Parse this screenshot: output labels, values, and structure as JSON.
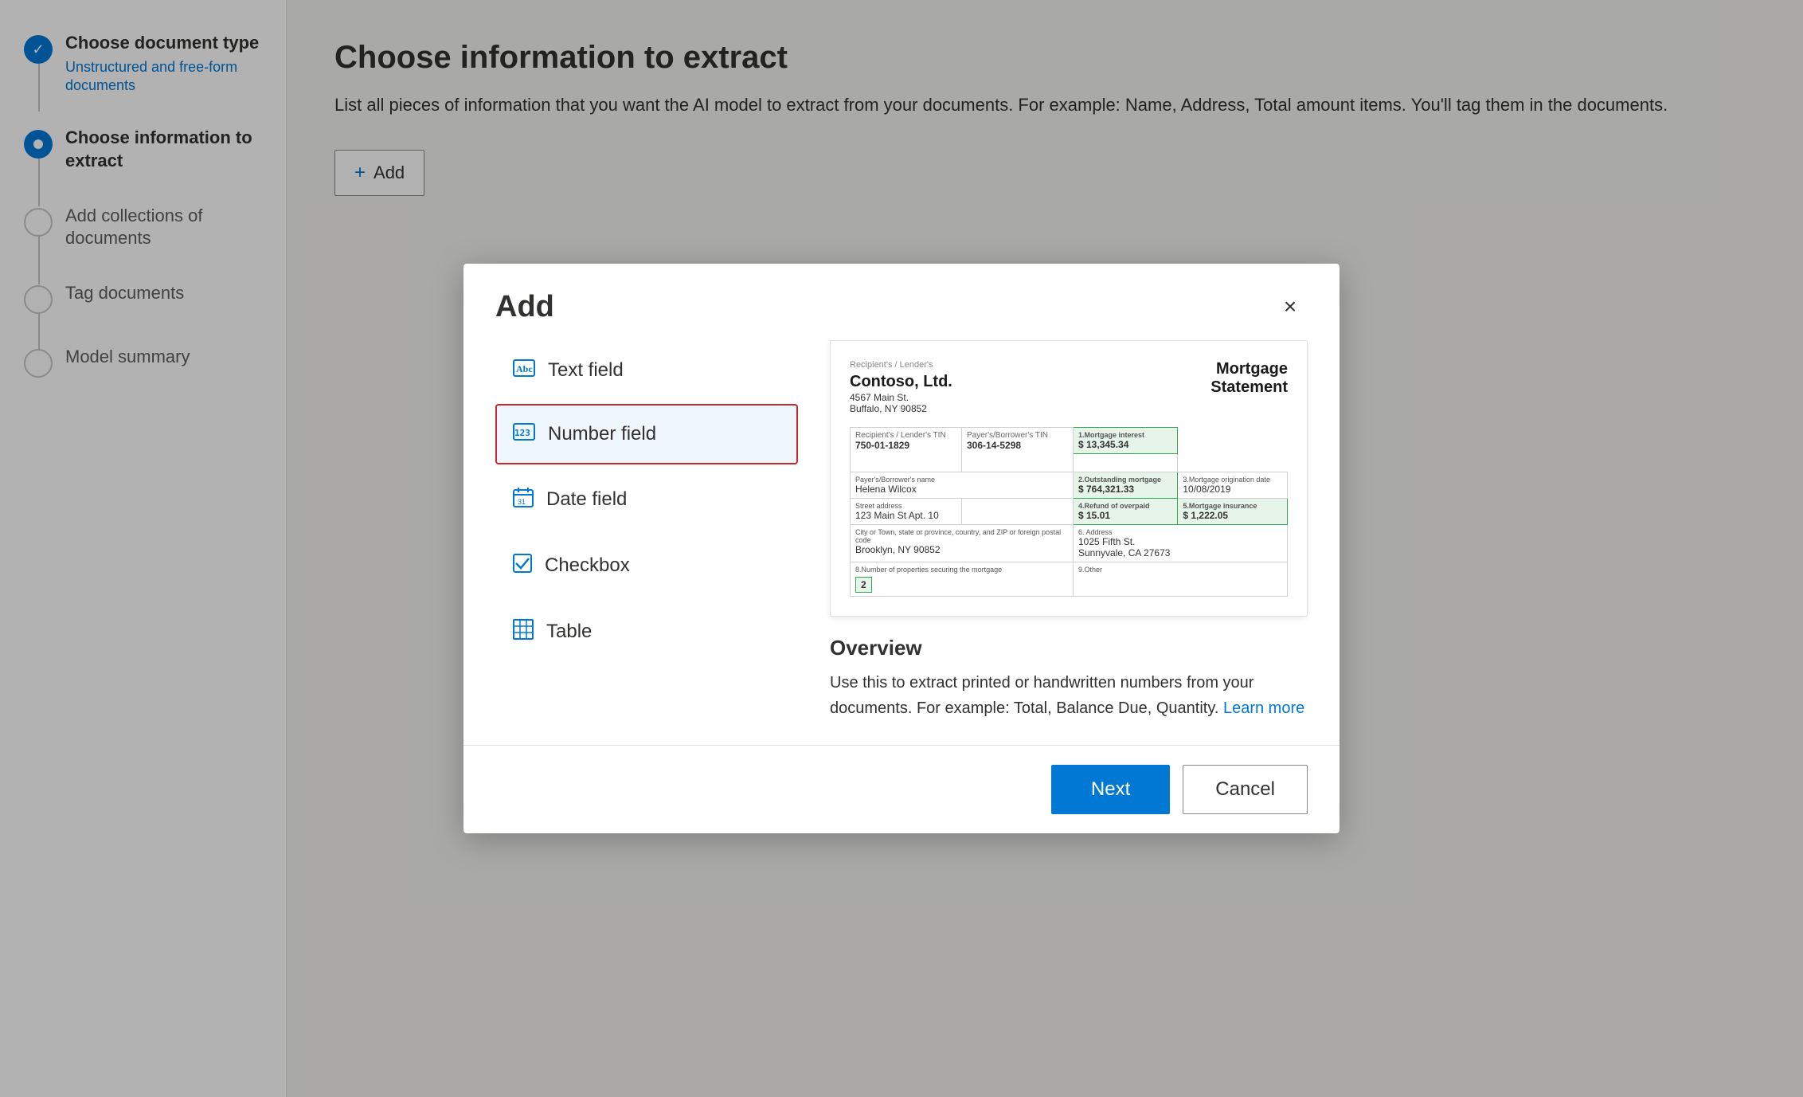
{
  "sidebar": {
    "steps": [
      {
        "id": "choose-document-type",
        "label": "Choose document type",
        "sublabel": "Unstructured and free-form documents",
        "state": "completed",
        "icon": "✓"
      },
      {
        "id": "choose-information",
        "label": "Choose information to extract",
        "sublabel": "",
        "state": "active",
        "icon": "●"
      },
      {
        "id": "add-collections",
        "label": "Add collections of documents",
        "sublabel": "",
        "state": "inactive",
        "icon": ""
      },
      {
        "id": "tag-documents",
        "label": "Tag documents",
        "sublabel": "",
        "state": "inactive",
        "icon": ""
      },
      {
        "id": "model-summary",
        "label": "Model summary",
        "sublabel": "",
        "state": "inactive",
        "icon": ""
      }
    ]
  },
  "main": {
    "title": "Choose information to extract",
    "description": "List all pieces of information that you want the AI model to extract from your documents. For example: Name, Address, Total amount items. You'll tag them in the documents.",
    "add_button_label": "Add"
  },
  "modal": {
    "title": "Add",
    "close_label": "×",
    "fields": [
      {
        "id": "text-field",
        "label": "Text field",
        "icon": "Abc",
        "selected": false
      },
      {
        "id": "number-field",
        "label": "Number field",
        "icon": "123",
        "selected": true
      },
      {
        "id": "date-field",
        "label": "Date field",
        "icon": "📅",
        "selected": false
      },
      {
        "id": "checkbox",
        "label": "Checkbox",
        "icon": "☑",
        "selected": false
      },
      {
        "id": "table",
        "label": "Table",
        "icon": "⊞",
        "selected": false
      }
    ],
    "preview": {
      "document": {
        "company": "Contoso, Ltd.",
        "address": "4567 Main St.\nBuffalo, NY 90852",
        "doc_type": "Mortgage\nStatement",
        "recipient_tin_label": "Recipient's / Lender's TIN",
        "recipient_tin": "750-01-1829",
        "payer_tin_label": "Payer's/Borrower's TIN",
        "payer_tin": "306-14-5298",
        "mortgage_interest_label": "1.Mortgage interest",
        "mortgage_interest": "$ 13,345.34",
        "outstanding_mortgage_label": "2.Outstanding mortgage",
        "outstanding_mortgage": "$ 764,321.33",
        "origination_date_label": "3.Mortgage origination date",
        "origination_date": "10/08/2019",
        "payer_name_label": "Payer's/Borrower's name",
        "payer_name": "Helena Wilcox",
        "refund_label": "4.Refund of overpaid",
        "refund": "$ 15.01",
        "insurance_label": "5.Mortgage insurance",
        "insurance": "$ 1,222.05",
        "address_label": "Street address",
        "street_address": "123 Main St Apt. 10",
        "city_label": "City or Town, state or province, country, and ZIP or foreign postal code",
        "city": "Brooklyn, NY 90852",
        "address_6_label": "6. Address",
        "address_6": "1025 Fifth St.\nSunnyvale, CA 27673",
        "properties_label": "8.Number of properties securing the mortgage",
        "properties": "2",
        "other_label": "9.Other"
      },
      "overview_title": "Overview",
      "overview_text": "Use this to extract printed or handwritten numbers from your documents. For example: Total, Balance Due, Quantity.",
      "learn_more_label": "Learn more"
    },
    "footer": {
      "next_label": "Next",
      "cancel_label": "Cancel"
    }
  }
}
